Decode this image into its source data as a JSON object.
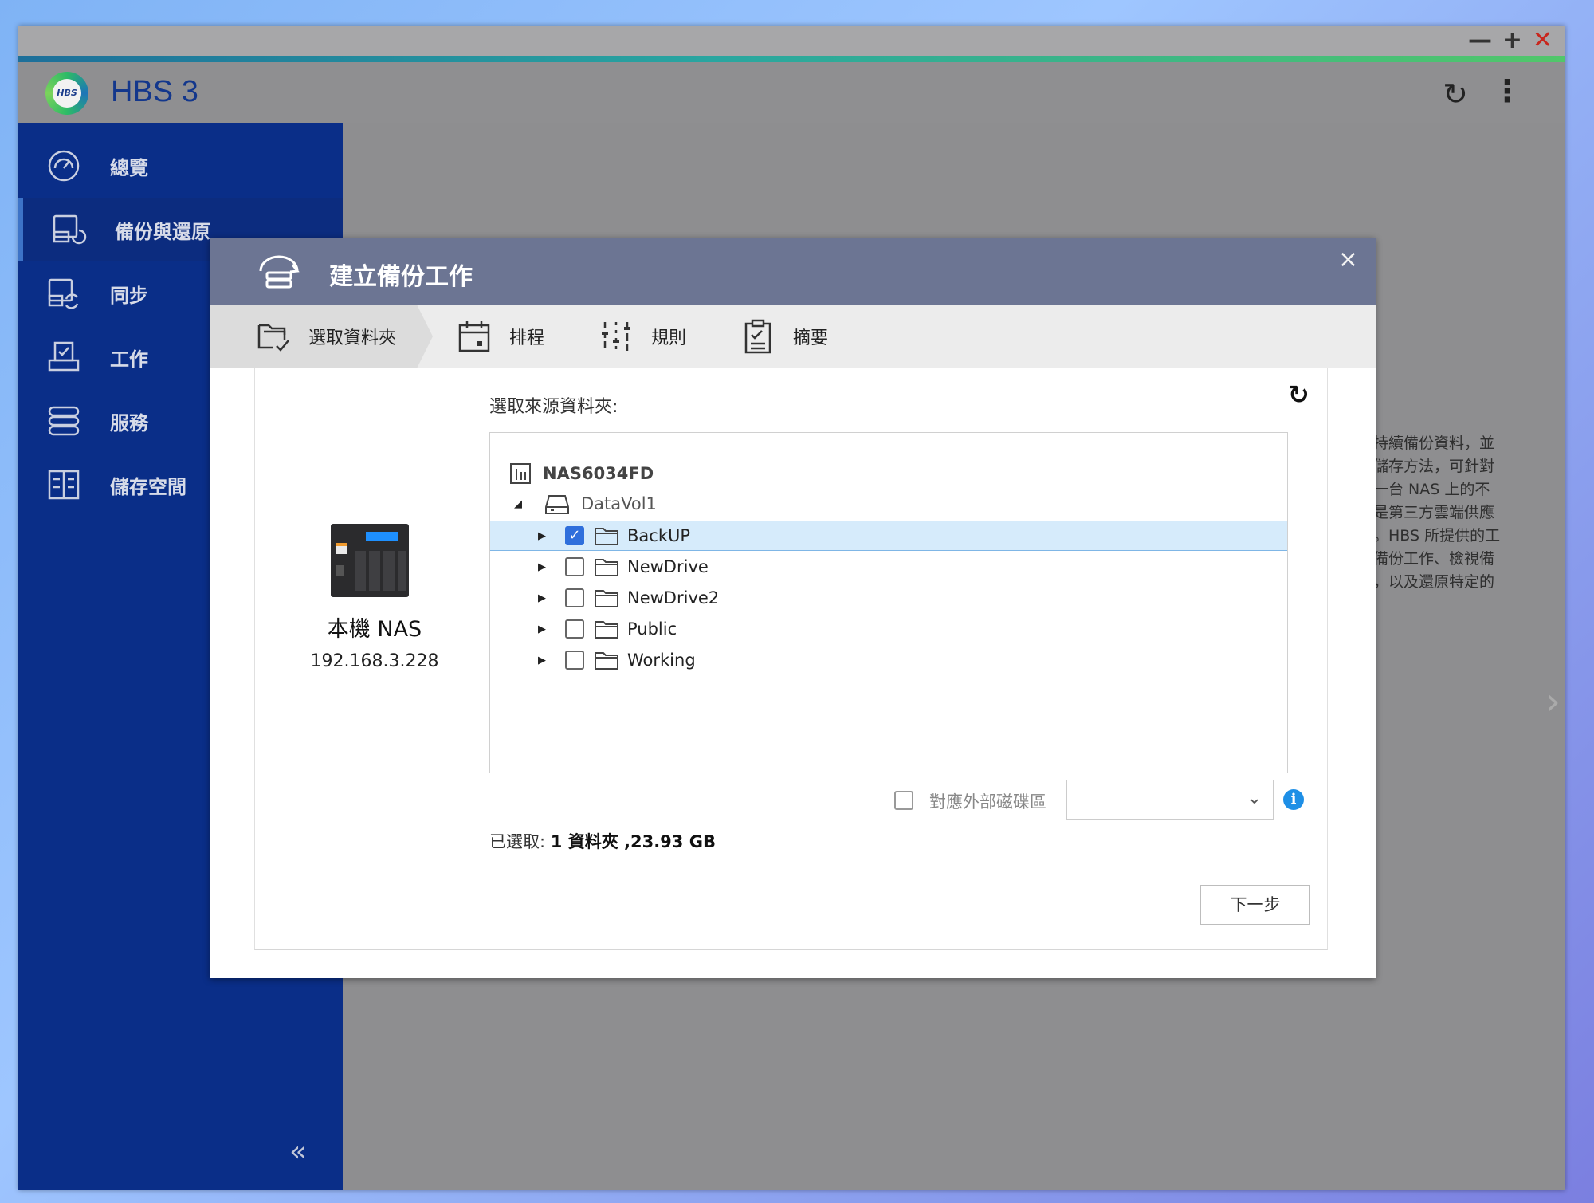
{
  "window": {
    "controls": {
      "minimize": "—",
      "maximize": "+",
      "close": "✕"
    }
  },
  "app": {
    "logo_text": "HBS",
    "title": "HBS 3",
    "refresh_icon": "refresh-icon",
    "more_icon": "more-vertical-icon"
  },
  "sidebar": {
    "items": [
      {
        "label": "總覽",
        "icon": "dashboard-gauge-icon"
      },
      {
        "label": "備份與還原",
        "icon": "backup-restore-icon",
        "active": true
      },
      {
        "label": "同步",
        "icon": "sync-icon"
      },
      {
        "label": "工作",
        "icon": "job-tray-icon"
      },
      {
        "label": "服務",
        "icon": "services-icon"
      },
      {
        "label": "儲存空間",
        "icon": "storage-space-icon"
      }
    ],
    "collapse_label": "«"
  },
  "background_text": {
    "lines": [
      "持續備份資料，並",
      "儲存方法，可針對",
      "一台 NAS 上的不",
      "是第三方雲端供應",
      "。HBS 所提供的工",
      "備份工作、檢視備",
      "，以及還原特定的"
    ]
  },
  "dialog": {
    "title": "建立備份工作",
    "close_label": "×",
    "steps": [
      {
        "label": "選取資料夾",
        "icon": "select-folder-icon",
        "active": true
      },
      {
        "label": "排程",
        "icon": "calendar-icon"
      },
      {
        "label": "規則",
        "icon": "rules-sliders-icon"
      },
      {
        "label": "摘要",
        "icon": "summary-clipboard-icon"
      }
    ],
    "source": {
      "device_name": "本機 NAS",
      "ip": "192.168.3.228"
    },
    "tree": {
      "label": "選取來源資料夾:",
      "root": "NAS6034FD",
      "volume": "DataVol1",
      "folders": [
        {
          "name": "BackUP",
          "checked": true,
          "selected": true
        },
        {
          "name": "NewDrive",
          "checked": false
        },
        {
          "name": "NewDrive2",
          "checked": false
        },
        {
          "name": "Public",
          "checked": false
        },
        {
          "name": "Working",
          "checked": false
        }
      ]
    },
    "external": {
      "label": "對應外部磁碟區",
      "select_value": ""
    },
    "summary": {
      "prefix": "已選取: ",
      "value": "1 資料夾 ,23.93 GB"
    },
    "next_label": "下一步"
  },
  "colors": {
    "sidebar": "#0a2e88",
    "dialog_header": "#6c7593",
    "accent_title": "#13378c",
    "checkbox": "#2f6fdc",
    "selected_row": "#d6ebfb"
  }
}
